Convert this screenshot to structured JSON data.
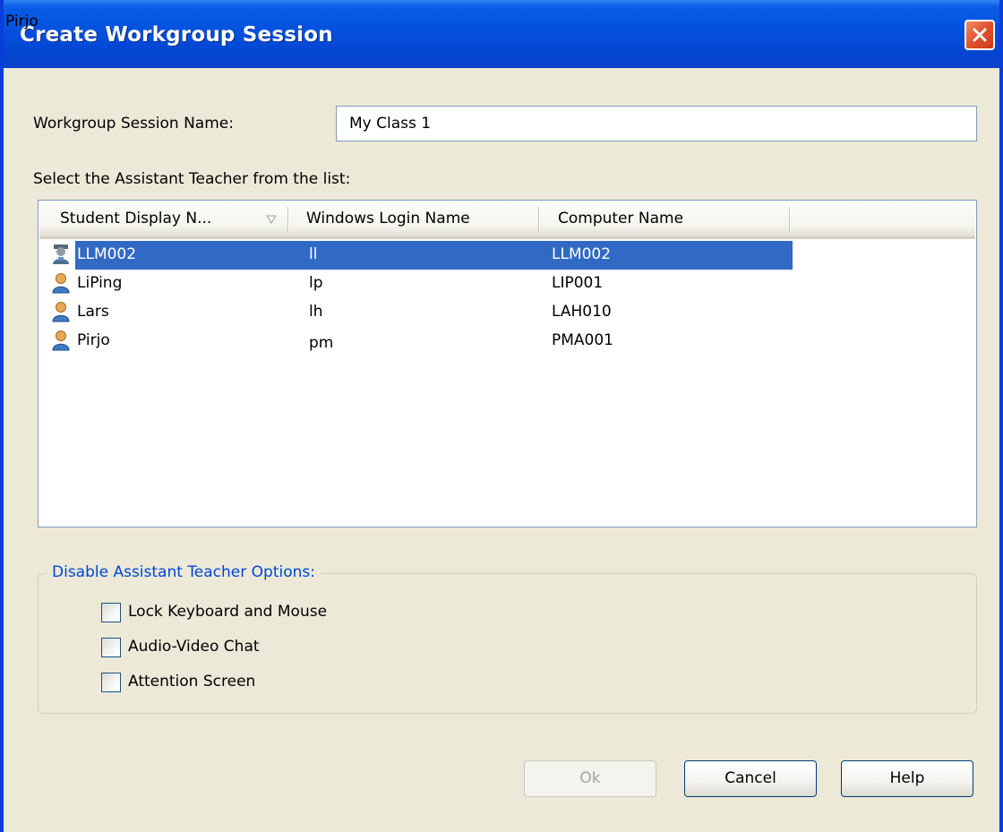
{
  "app_label": "Pirjo",
  "dialog": {
    "title": "Create Workgroup Session",
    "session_name_label": "Workgroup Session Name:",
    "session_name_value": "My Class 1",
    "list_label": "Select the Assistant Teacher from the list:"
  },
  "list": {
    "columns": [
      {
        "label": "Student Display N..."
      },
      {
        "label": "Windows Login Name"
      },
      {
        "label": "Computer Name"
      }
    ],
    "rows": [
      {
        "display_name": "LLM002",
        "login": "ll",
        "computer": "LLM002",
        "selected": true,
        "icon": "teacher-user-icon"
      },
      {
        "display_name": "LiPing",
        "login": "lp",
        "computer": "LIP001",
        "selected": false,
        "icon": "student-user-icon"
      },
      {
        "display_name": "Lars",
        "login": "lh",
        "computer": "LAH010",
        "selected": false,
        "icon": "student-user-icon"
      },
      {
        "display_name": "Pirjo",
        "login": "pm",
        "computer": "PMA001",
        "selected": false,
        "icon": "student-user-icon"
      }
    ]
  },
  "options": {
    "legend": "Disable Assistant Teacher Options:",
    "items": [
      {
        "label": "Lock Keyboard and Mouse",
        "checked": false
      },
      {
        "label": "Audio-Video Chat",
        "checked": false
      },
      {
        "label": "Attention Screen",
        "checked": false
      }
    ]
  },
  "buttons": {
    "ok": "Ok",
    "cancel": "Cancel",
    "help": "Help"
  },
  "colors": {
    "titlebar": "#0453df",
    "selection": "#316ac5",
    "legend": "#0046d5",
    "dialog_bg": "#ece9d8"
  }
}
